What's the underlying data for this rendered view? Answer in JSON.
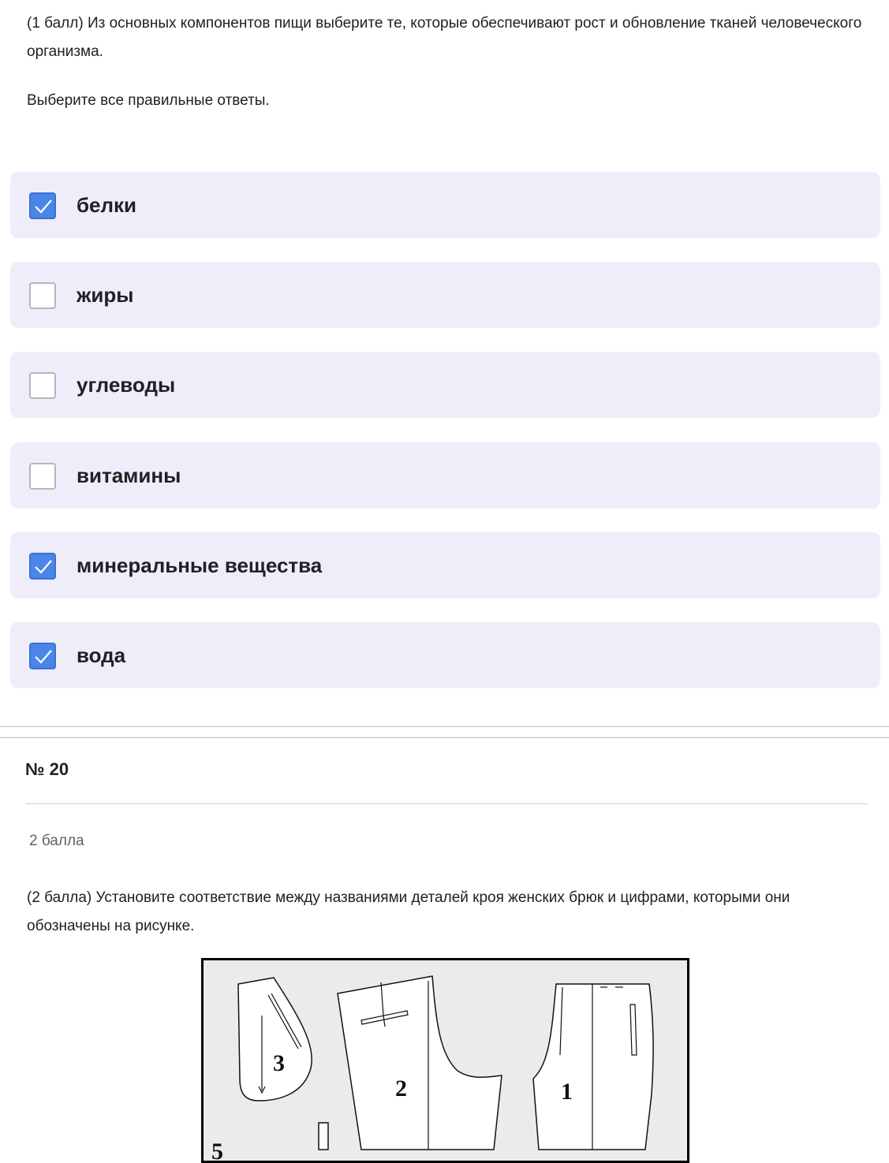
{
  "question19": {
    "text": "(1 балл) Из основных компонентов пищи выберите те, которые обеспечивают рост и обновление тканей человеческого организма.",
    "instruction": "Выберите все правильные ответы.",
    "options": [
      {
        "label": "белки",
        "checked": true
      },
      {
        "label": "жиры",
        "checked": false
      },
      {
        "label": "углеводы",
        "checked": false
      },
      {
        "label": "витамины",
        "checked": false
      },
      {
        "label": "минеральные вещества",
        "checked": true
      },
      {
        "label": "вода",
        "checked": true
      }
    ]
  },
  "question20": {
    "number": "№ 20",
    "points": "2 балла",
    "text": "(2 балла) Установите соответствие между названиями деталей кроя женских брюк и цифрами, которыми они обозначены на рисунке.",
    "figure_labels": [
      "1",
      "2",
      "3",
      "5"
    ]
  },
  "colors": {
    "option_bg": "#efedf9",
    "checkbox_checked": "#4a86e8"
  }
}
